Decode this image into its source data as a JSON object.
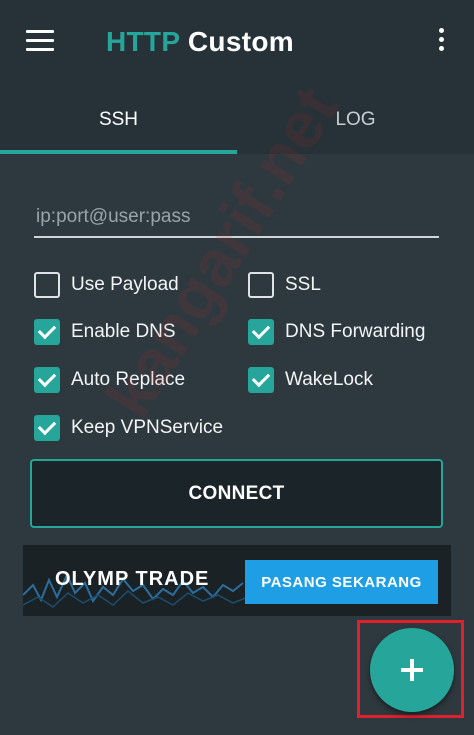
{
  "app": {
    "title_accent": "HTTP",
    "title_rest": "Custom",
    "icons": {
      "menu": "hamburger-menu-icon",
      "overflow": "vertical-dots-icon",
      "fab": "plus-icon"
    }
  },
  "tabs": [
    {
      "label": "SSH",
      "active": true
    },
    {
      "label": "LOG",
      "active": false
    }
  ],
  "ssh": {
    "host_input": {
      "value": "",
      "placeholder": "ip:port@user:pass"
    },
    "options": [
      {
        "label": "Use Payload",
        "checked": false
      },
      {
        "label": "SSL",
        "checked": false
      },
      {
        "label": "Enable DNS",
        "checked": true
      },
      {
        "label": "DNS Forwarding",
        "checked": true
      },
      {
        "label": "Auto Replace",
        "checked": true
      },
      {
        "label": "WakeLock",
        "checked": true
      },
      {
        "label": "Keep VPNService",
        "checked": true
      }
    ],
    "connect_label": "CONNECT"
  },
  "ad": {
    "brand": "OLYMP TRADE",
    "cta": "PASANG SEKARANG"
  },
  "watermark": "kangarif.net",
  "colors": {
    "accent": "#26a69a",
    "background": "#2e393f",
    "toolbar": "#263238",
    "ad_button": "#1e9ee5",
    "highlight": "#e0202a"
  }
}
